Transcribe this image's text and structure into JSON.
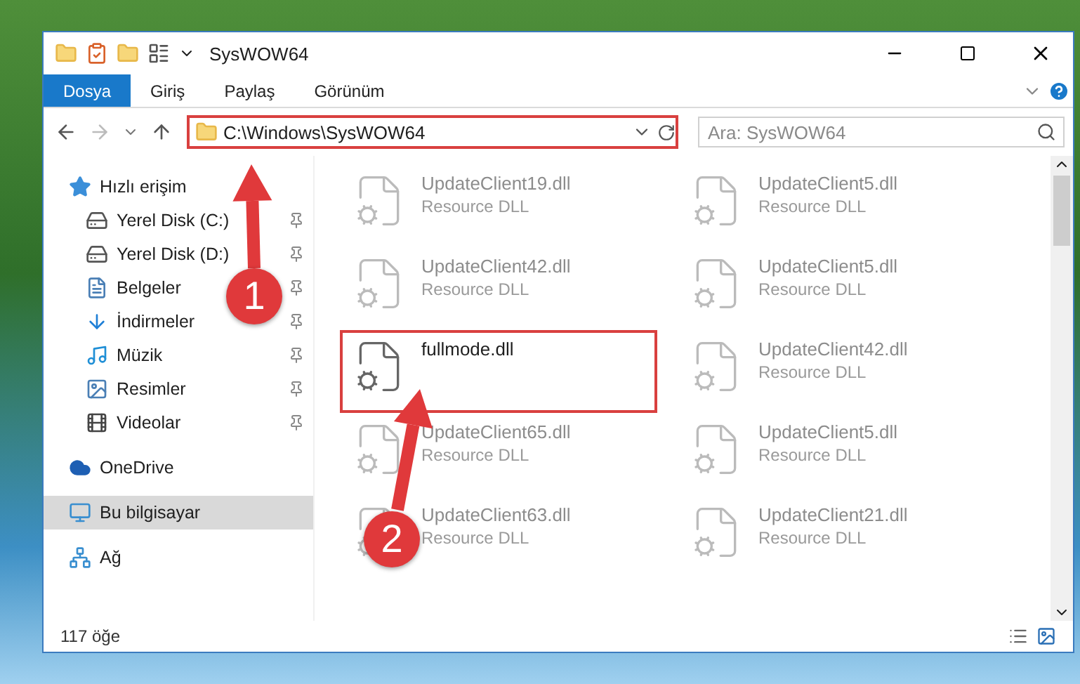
{
  "window": {
    "title": "SysWOW64"
  },
  "ribbon_tabs": [
    {
      "label": "Dosya",
      "selected": true
    },
    {
      "label": "Giriş",
      "selected": false
    },
    {
      "label": "Paylaş",
      "selected": false
    },
    {
      "label": "Görünüm",
      "selected": false
    }
  ],
  "address": {
    "path": "C:\\Windows\\SysWOW64",
    "highlighted": true
  },
  "search": {
    "placeholder": "Ara: SysWOW64"
  },
  "sidebar": {
    "items": [
      {
        "label": "Hızlı erişim",
        "kind": "star",
        "selected": false,
        "children": [
          {
            "label": "Yerel Disk (C:)",
            "kind": "drive",
            "pinned": true,
            "selected": false
          },
          {
            "label": "Yerel Disk (D:)",
            "kind": "drive",
            "pinned": true,
            "selected": false
          },
          {
            "label": "Belgeler",
            "kind": "documents",
            "pinned": true,
            "selected": false
          },
          {
            "label": "İndirmeler",
            "kind": "downloads",
            "pinned": true,
            "selected": false
          },
          {
            "label": "Müzik",
            "kind": "music",
            "pinned": true,
            "selected": false
          },
          {
            "label": "Resimler",
            "kind": "pictures",
            "pinned": true,
            "selected": false
          },
          {
            "label": "Videolar",
            "kind": "videos",
            "pinned": true,
            "selected": false
          }
        ]
      },
      {
        "label": "OneDrive",
        "kind": "cloud",
        "selected": false
      },
      {
        "label": "Bu bilgisayar",
        "kind": "computer",
        "selected": true
      },
      {
        "label": "Ağ",
        "kind": "network",
        "selected": false
      }
    ]
  },
  "files": [
    {
      "name": "UpdateClient19.dll",
      "subtitle": "Resource DLL",
      "highlighted": false
    },
    {
      "name": "UpdateClient5.dll",
      "subtitle": "Resource DLL",
      "highlighted": false
    },
    {
      "name": "UpdateClient42.dll",
      "subtitle": "Resource DLL",
      "highlighted": false
    },
    {
      "name": "UpdateClient5.dll",
      "subtitle": "Resource DLL",
      "highlighted": false
    },
    {
      "name": "fullmode.dll",
      "highlighted": true
    },
    {
      "name": "UpdateClient42.dll",
      "subtitle": "Resource DLL",
      "highlighted": false
    },
    {
      "name": "UpdateClient65.dll",
      "subtitle": "Resource DLL",
      "highlighted": false
    },
    {
      "name": "UpdateClient5.dll",
      "subtitle": "Resource DLL",
      "highlighted": false
    },
    {
      "name": "UpdateClient63.dll",
      "subtitle": "Resource DLL",
      "highlighted": false
    },
    {
      "name": "UpdateClient21.dll",
      "subtitle": "Resource DLL",
      "highlighted": false
    }
  ],
  "annotations": [
    {
      "number": "1"
    },
    {
      "number": "2"
    }
  ],
  "status_bar": {
    "count": "117 öğe"
  }
}
